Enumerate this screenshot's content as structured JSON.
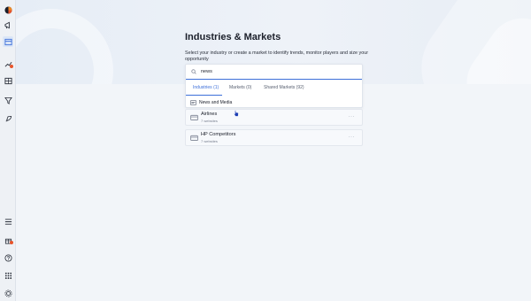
{
  "page": {
    "title": "Industries & Markets",
    "subtitle": "Select your industry or create a market to identify trends, monitor players and size your opportunity"
  },
  "search": {
    "value": "news"
  },
  "tabs": [
    {
      "label": "Industries (1)",
      "active": true
    },
    {
      "label": "Markets (0)",
      "active": false
    },
    {
      "label": "Shared Markets (92)",
      "active": false
    }
  ],
  "results": [
    {
      "label": "News and Media",
      "icon": "industry-icon"
    }
  ],
  "markets": [
    {
      "name": "Airlines",
      "count": "7 websites",
      "icon": "market-icon"
    },
    {
      "name": "HP Competitors",
      "count": "7 websites",
      "icon": "market-icon"
    }
  ],
  "sidebar": {
    "icons": [
      "logo-icon",
      "megaphone-icon",
      "industries-icon",
      "trends-icon",
      "table-icon",
      "funnel-icon",
      "rocket-icon",
      "menu-icon",
      "gift-icon",
      "help-icon",
      "apps-icon",
      "settings-icon"
    ]
  },
  "colors": {
    "accent": "#3d6fd9",
    "badge": "#e8542b"
  }
}
